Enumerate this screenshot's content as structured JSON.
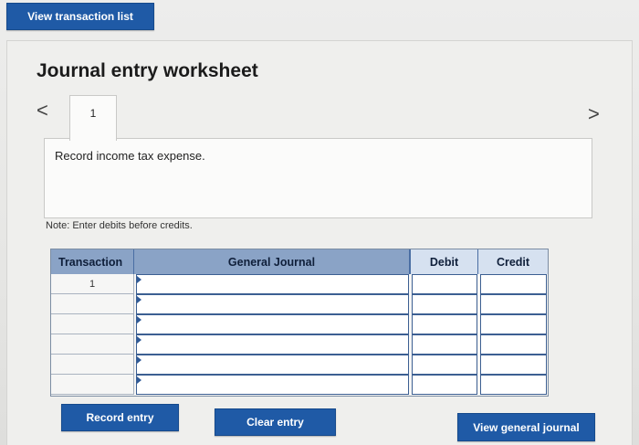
{
  "header": {
    "view_transaction_list": "View transaction list"
  },
  "worksheet": {
    "title": "Journal entry worksheet",
    "nav": {
      "prev_icon": "<",
      "next_icon": ">"
    },
    "tabs": [
      {
        "label": "1"
      }
    ],
    "description": "Record income tax expense.",
    "note": "Note: Enter debits before credits."
  },
  "table": {
    "columns": [
      "Transaction",
      "General Journal",
      "Debit",
      "Credit"
    ],
    "rows": [
      {
        "transaction": "1",
        "account": "",
        "debit": "",
        "credit": ""
      },
      {
        "transaction": "",
        "account": "",
        "debit": "",
        "credit": ""
      },
      {
        "transaction": "",
        "account": "",
        "debit": "",
        "credit": ""
      },
      {
        "transaction": "",
        "account": "",
        "debit": "",
        "credit": ""
      },
      {
        "transaction": "",
        "account": "",
        "debit": "",
        "credit": ""
      },
      {
        "transaction": "",
        "account": "",
        "debit": "",
        "credit": ""
      }
    ]
  },
  "buttons": {
    "record_entry": "Record entry",
    "clear_entry": "Clear entry",
    "view_general_journal": "View general journal"
  },
  "colors": {
    "button_blue": "#1f5aa6",
    "header_blue": "#5e86bf",
    "input_border": "#3c5f92"
  }
}
